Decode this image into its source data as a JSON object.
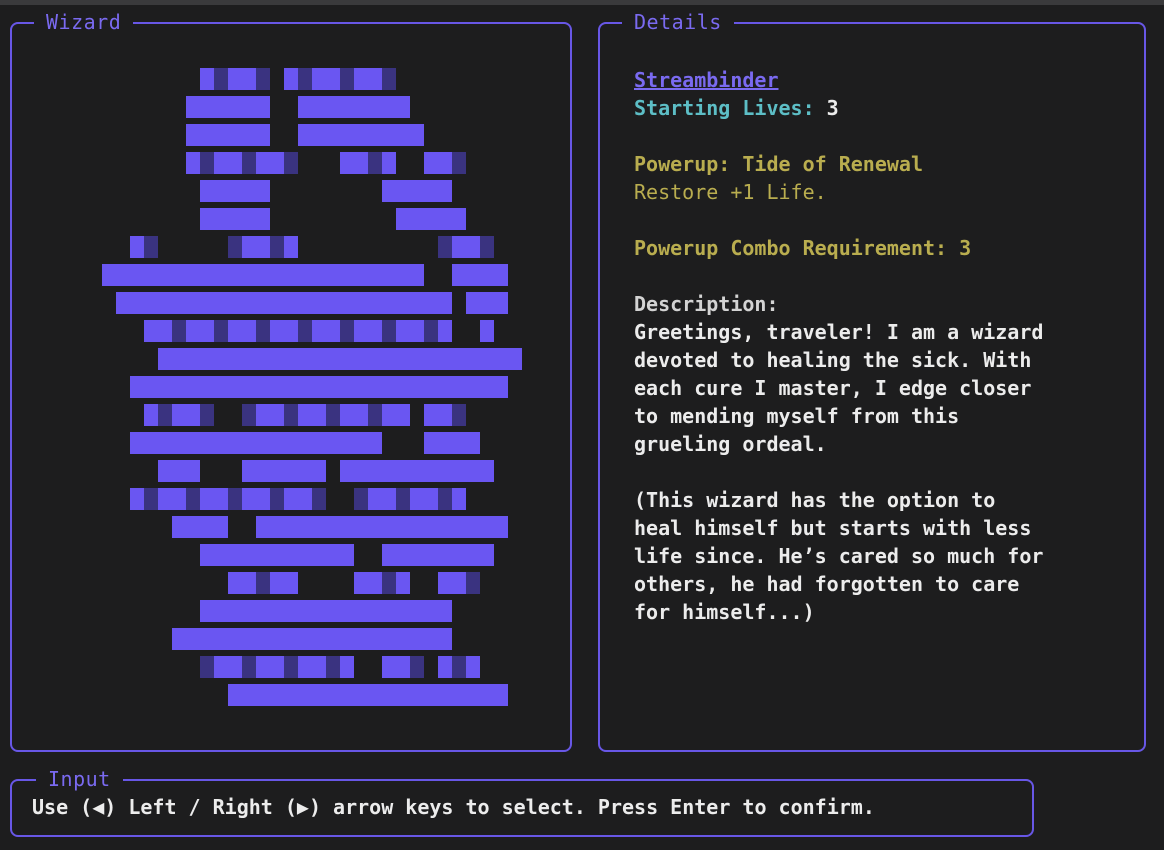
{
  "colors": {
    "accent": "#6857e6",
    "pixel_light": "#6a56f2",
    "pixel_dark": "#3a3380",
    "cyan": "#5dbec6",
    "olive": "#b9ad4f",
    "background": "#1d1d1e"
  },
  "panels": {
    "wizard_title": "Wizard",
    "details_title": "Details",
    "input_title": "Input"
  },
  "details": {
    "name": "Streambinder",
    "lives_label": "Starting Lives:",
    "lives_value": "3",
    "powerup_label": "Powerup: Tide of Renewal",
    "powerup_desc": "Restore +1 Life.",
    "combo_label": "Powerup Combo Requirement: 3",
    "description_label": "Description:",
    "description_lines": [
      "Greetings, traveler! I am a wizard",
      "devoted to healing the sick. With",
      "each cure I master, I edge closer",
      "to mending myself from this",
      "grueling ordeal."
    ],
    "note_lines": [
      "(This wizard has the option to",
      "heal himself but starts with less",
      "life since. He’s cared so much for",
      "others, he had forgotten to care",
      "for himself...)"
    ]
  },
  "input": {
    "instruction": "Use (◀) Left / Right (▶) arrow keys to select. Press Enter to confirm."
  },
  "wizard_art": [
    "           ..... ........          ",
    "          ......  ........         ",
    "          ......  .........        ",
    "          ........   ....  ...     ",
    "           .....        .....      ",
    "           .....         .....     ",
    "      ..     .....          ....   ",
    "    .......................  ....  ",
    "     ........................ ... ",
    "       ......................  .  ",
    "        ..........................",
    "      ...........................  ",
    "       .....  ............ ...    ",
    "      ..................   ....   ",
    "        ...   ...... ...........  ",
    "      ..............  ........    ",
    "         ....  ..................  ",
    "           ...........  ........   ",
    "             .....    ....  ...    ",
    "           ..................     ",
    "         ....................     ",
    "           ...........  ... ...    ",
    "             ....................  "
  ]
}
